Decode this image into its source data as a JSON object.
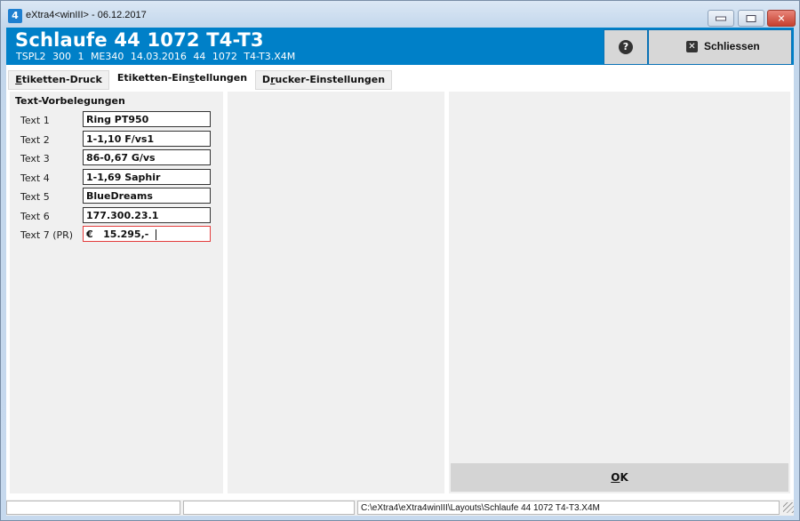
{
  "window": {
    "app_icon_label": "4",
    "title": "eXtra4<winIII> - 06.12.2017",
    "controls": {
      "minimize": "minimize",
      "maximize": "maximize",
      "close": "✕"
    }
  },
  "header": {
    "title": "Schlaufe 44 1072 T4-T3",
    "subtitle": "TSPL2   300 1   ME340  14.03.2016  44 1072 T4-T3.X4M",
    "help_glyph": "?",
    "close_button": {
      "icon": "✕",
      "label": "Schliessen"
    },
    "background_color": "#0080c8"
  },
  "tabs": [
    {
      "label_mnemonic": "E",
      "label_rest": "tiketten-Druck",
      "active": false
    },
    {
      "label_prefix": "Etiketten-Ein",
      "label_mnemonic": "s",
      "label_rest": "tellungen",
      "active": true
    },
    {
      "label_prefix": "D",
      "label_mnemonic": "r",
      "label_rest": "ucker-Einstellungen",
      "active": false
    }
  ],
  "text_presets": {
    "title": "Text-Vorbelegungen",
    "rows": [
      {
        "label": "Text 1",
        "value": "Ring PT950"
      },
      {
        "label": "Text 2",
        "value": "1-1,10 F/vs1"
      },
      {
        "label": "Text 3",
        "value": "86-0,67 G/vs"
      },
      {
        "label": "Text 4",
        "value": "1-1,69 Saphir"
      },
      {
        "label": "Text 5",
        "value": "BlueDreams"
      },
      {
        "label": "Text 6",
        "value": "177.300.23.1"
      },
      {
        "label": "Text 7 (PR)",
        "value": "€   15.295,-"
      }
    ]
  },
  "ok_button": {
    "mnemonic": "O",
    "rest": "K"
  },
  "statusbar": {
    "cell1": "",
    "cell2": "",
    "path": "C:\\eXtra4\\eXtra4winIII\\Layouts\\Schlaufe 44 1072 T4-T3.X4M"
  }
}
